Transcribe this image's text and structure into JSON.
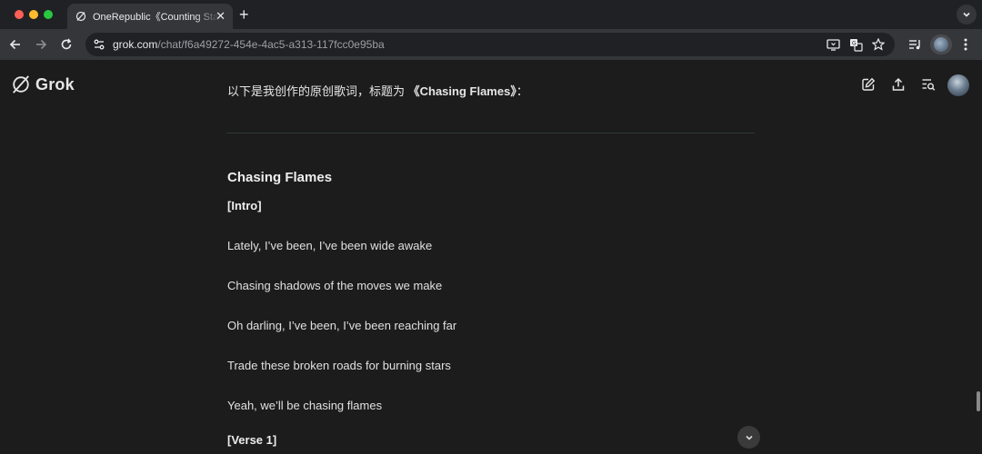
{
  "browser": {
    "tab": {
      "title": "OneRepublic《Counting Stars》",
      "close": "✕"
    },
    "new_tab": "+",
    "address": {
      "host": "grok.com",
      "path": "/chat/f6a49272-454e-4ac5-a313-117fcc0e95ba"
    }
  },
  "app": {
    "logo_text": "Grok"
  },
  "chat": {
    "intro_prefix": "以下是我创作的原创歌词，标题为 ",
    "intro_title": "《Chasing Flames》",
    "intro_suffix": "：",
    "song_title": "Chasing Flames",
    "sections": [
      {
        "label": "[Intro]",
        "lines": [
          "Lately, I’ve been, I’ve been wide awake",
          "Chasing shadows of the moves we make",
          "Oh darling, I’ve been, I’ve been reaching far",
          "Trade these broken roads for burning stars",
          "Yeah, we’ll be chasing flames"
        ]
      },
      {
        "label": "[Verse 1]"
      }
    ]
  },
  "icons": {
    "tab_favicon": "grok-icon",
    "back": "arrow-left-icon",
    "forward": "arrow-right-icon",
    "reload": "reload-icon",
    "site_info": "tune-icon",
    "install": "install-app-icon",
    "translate": "translate-icon",
    "bookmark": "star-icon",
    "media": "media-controls-icon",
    "menu": "kebab-menu-icon",
    "new_chat": "edit-icon",
    "share": "share-icon",
    "history": "history-icon",
    "scroll": "chevron-down-icon"
  }
}
